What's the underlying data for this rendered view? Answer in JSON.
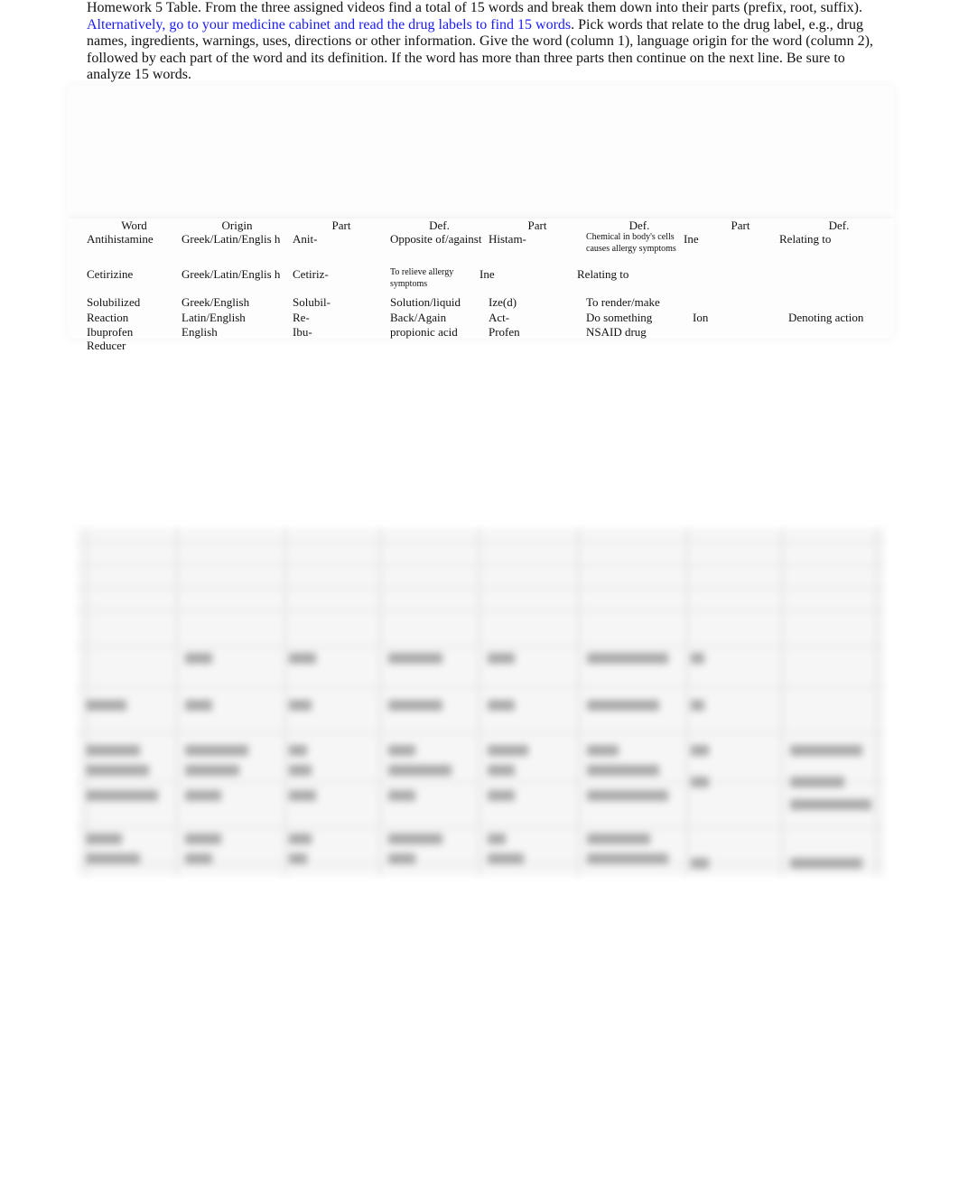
{
  "intro": {
    "text1": "Homework 5 Table. From the three assigned videos find a total of 15 words and break them down into their parts (prefix, root, suffix). ",
    "link": "Alternatively, go to your medicine cabinet and read the drug labels to find 15 words",
    "text2": ". Pick words that relate to the drug label, e.g., drug names, ingredients, warnings, uses, directions or other information. Give the word (column 1), language origin for the word (column 2), followed by each part of the word and its definition. If the word has more than three parts then continue on the next line. Be sure to analyze 15 words.",
    "link_color": "#1a1aff"
  },
  "table": {
    "headers": [
      "Word",
      "Origin",
      "Part",
      "Def.",
      "Part",
      "Def.",
      "Part",
      "Def."
    ],
    "rows": [
      [
        "Antihistamine",
        "Greek/Latin/Englis h",
        "Anit-",
        "Opposite of/against",
        "Histam-",
        "Chemical in body's cells causes allergy symptoms",
        "Ine",
        "Relating to"
      ],
      [
        "Cetirizine",
        "Greek/Latin/Englis h",
        "Cetiriz-",
        "To relieve allergy symptoms",
        "Ine",
        "Relating to",
        "",
        ""
      ],
      [
        "Solubilized",
        "Greek/English",
        "Solubil-",
        "Solution/liquid",
        "Ize(d)",
        "To render/make",
        "",
        ""
      ],
      [
        "Reaction",
        "Latin/English",
        "Re-",
        "Back/Again",
        "Act-",
        "Do something",
        "Ion",
        "Denoting action"
      ],
      [
        "Ibuprofen",
        "English",
        "Ibu-",
        "propionic acid",
        "Profen",
        "NSAID drug",
        "",
        ""
      ],
      [
        "Reducer",
        "",
        "",
        "",
        "",
        "",
        "",
        ""
      ]
    ]
  }
}
